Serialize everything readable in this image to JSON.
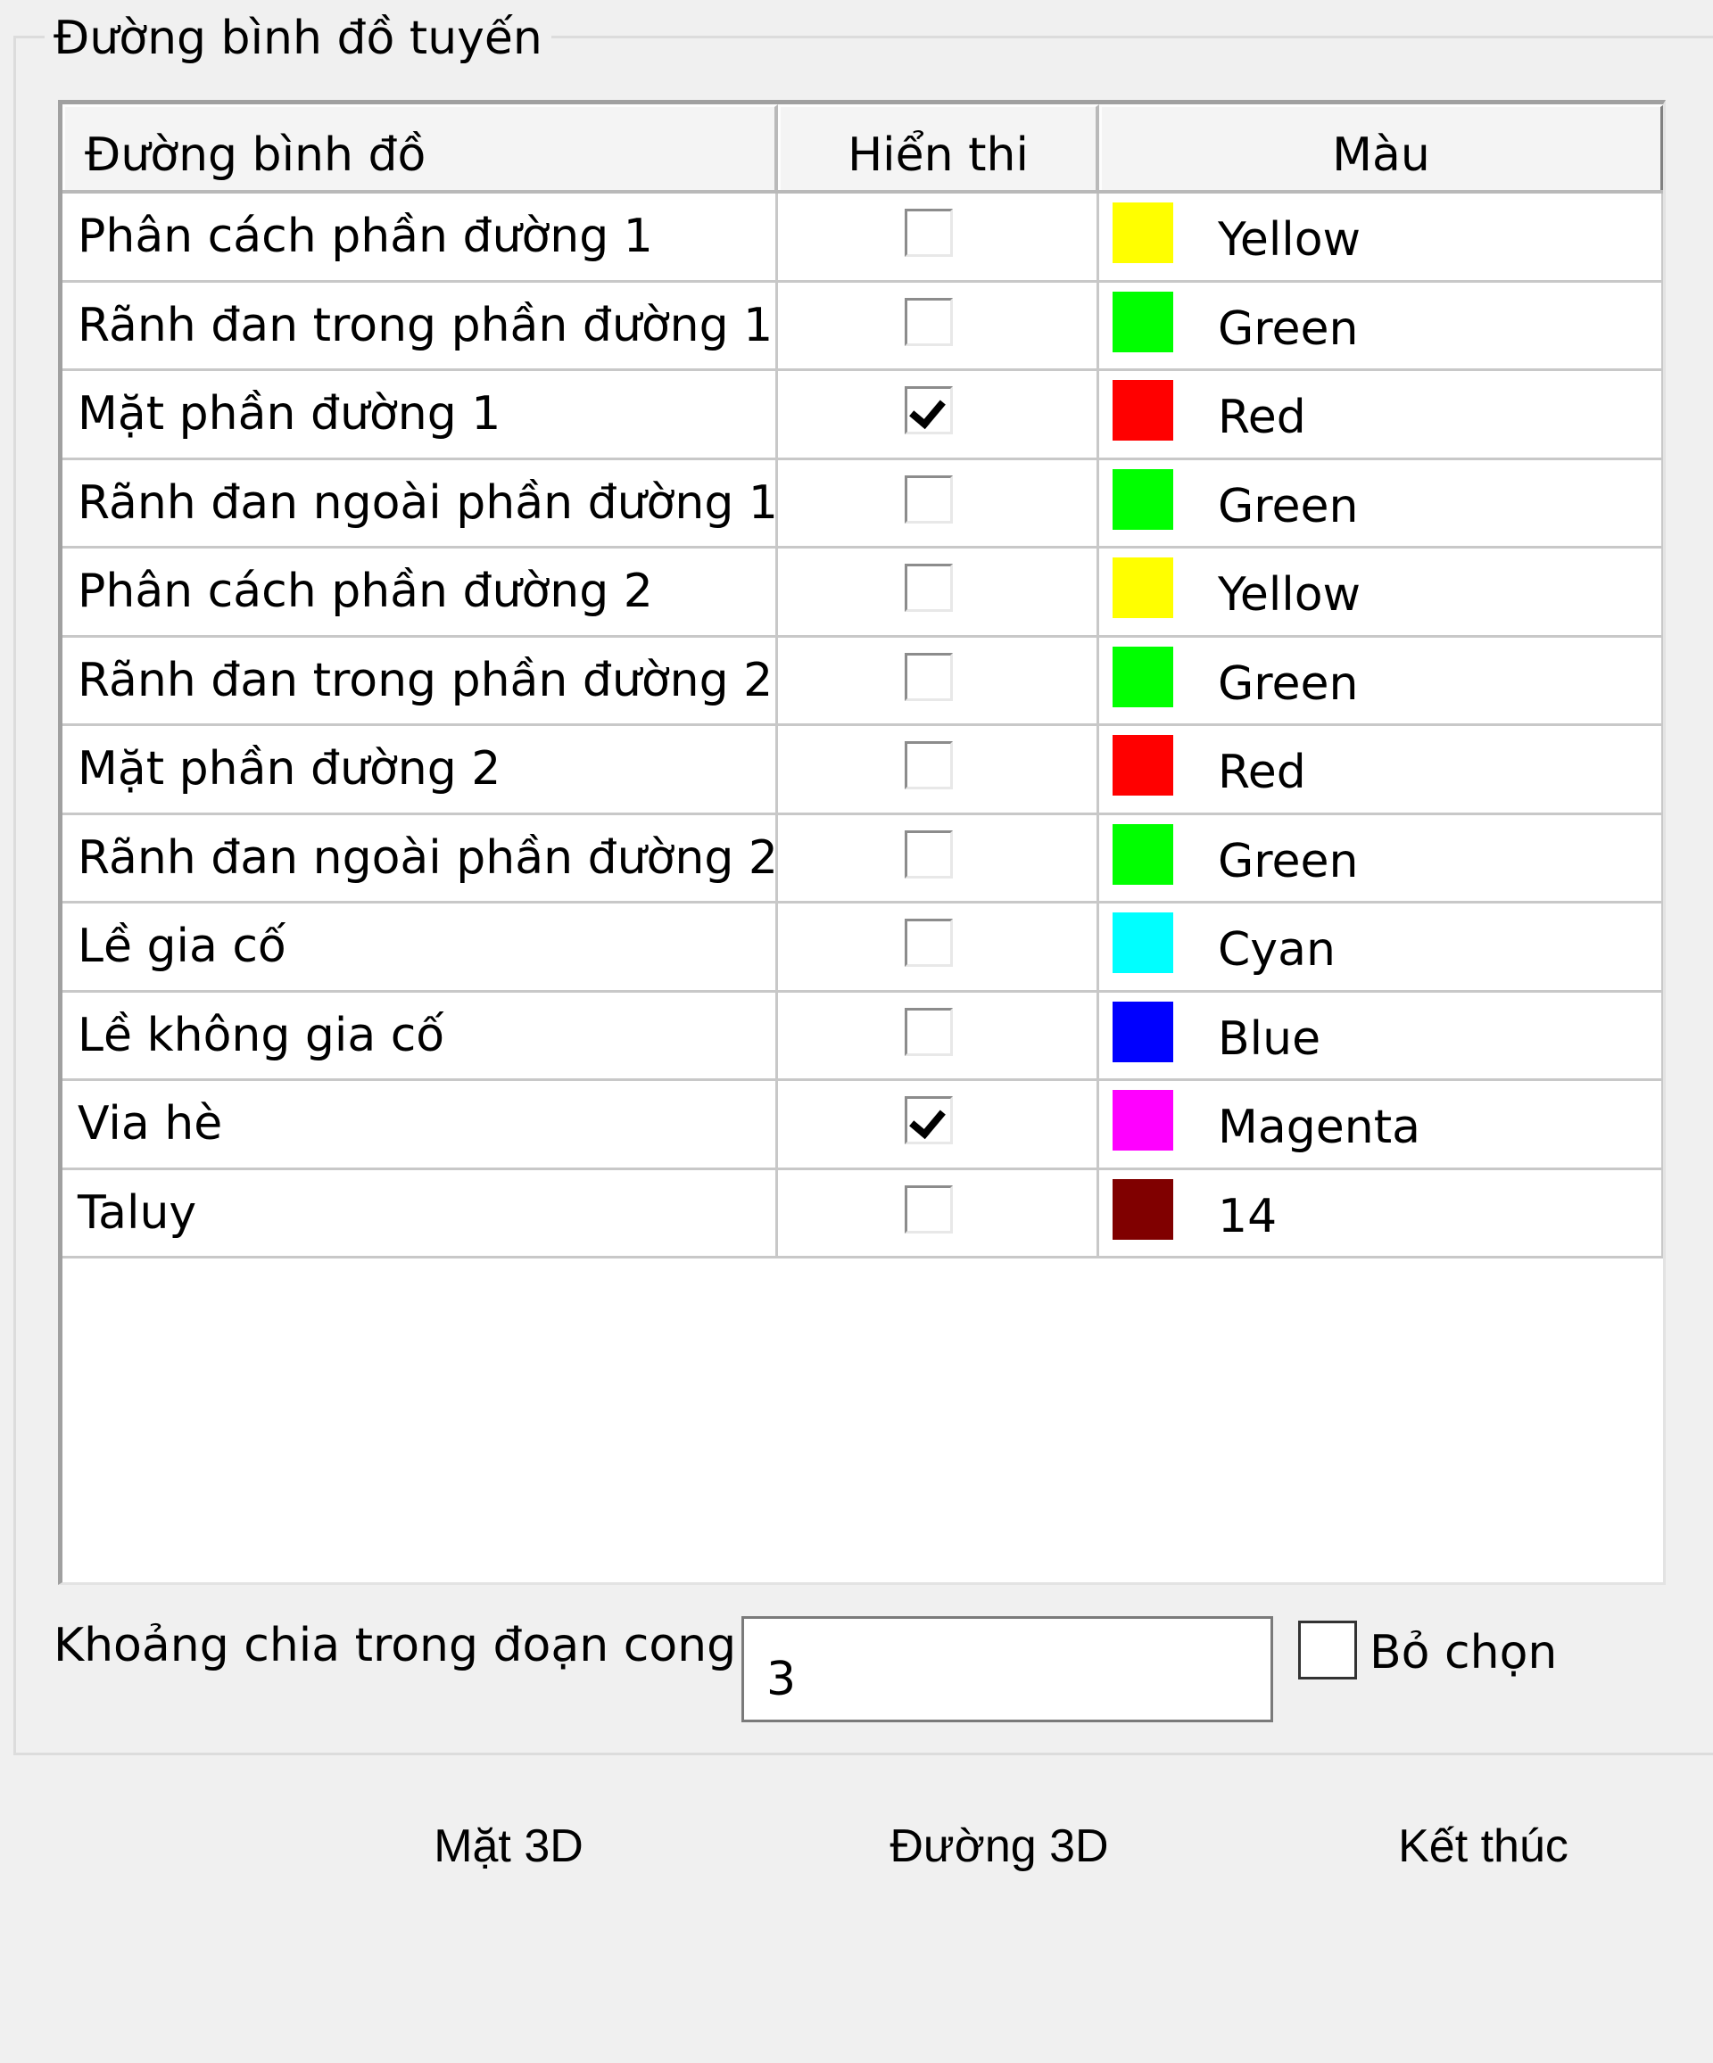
{
  "group": {
    "title": "Đường bình đồ tuyến"
  },
  "grid": {
    "columns": [
      "Đường bình đồ",
      "Hiển thi",
      "Màu"
    ],
    "rows": [
      {
        "name": "Phân cách phần đường 1",
        "visible": false,
        "color_name": "Yellow",
        "color_hex": "#ffff00"
      },
      {
        "name": "Rãnh đan trong phần đường 1",
        "visible": false,
        "color_name": "Green",
        "color_hex": "#00ff00"
      },
      {
        "name": "Mặt phần đường 1",
        "visible": true,
        "color_name": "Red",
        "color_hex": "#ff0000"
      },
      {
        "name": "Rãnh đan ngoài phần đường 1",
        "visible": false,
        "color_name": "Green",
        "color_hex": "#00ff00"
      },
      {
        "name": "Phân cách phần đường 2",
        "visible": false,
        "color_name": "Yellow",
        "color_hex": "#ffff00"
      },
      {
        "name": "Rãnh đan trong phần đường 2",
        "visible": false,
        "color_name": "Green",
        "color_hex": "#00ff00"
      },
      {
        "name": "Mặt phần đường 2",
        "visible": false,
        "color_name": "Red",
        "color_hex": "#ff0000"
      },
      {
        "name": "Rãnh đan ngoài phần đường 2",
        "visible": false,
        "color_name": "Green",
        "color_hex": "#00ff00"
      },
      {
        "name": "Lề gia cố",
        "visible": false,
        "color_name": "Cyan",
        "color_hex": "#00ffff"
      },
      {
        "name": "Lề không gia cố",
        "visible": false,
        "color_name": "Blue",
        "color_hex": "#0000ff"
      },
      {
        "name": "Via hè",
        "visible": true,
        "color_name": "Magenta",
        "color_hex": "#ff00ff"
      },
      {
        "name": "Taluy",
        "visible": false,
        "color_name": "14",
        "color_hex": "#800000"
      }
    ]
  },
  "spacing": {
    "label": "Khoảng chia trong đoạn cong",
    "value": "3"
  },
  "unselect": {
    "label": "Bỏ chọn",
    "checked": false
  },
  "buttons": {
    "surface_3d": "Mặt 3D",
    "line_3d": "Đường 3D",
    "finish": "Kết thúc"
  }
}
